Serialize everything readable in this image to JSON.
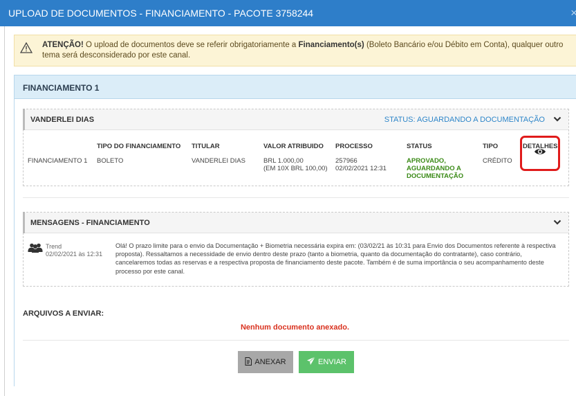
{
  "modal": {
    "title": "UPLOAD DE DOCUMENTOS - FINANCIAMENTO - PACOTE 3758244",
    "close_glyph": "×"
  },
  "alert": {
    "icon": "warning-triangle-icon",
    "strong": "ATENÇÃO!",
    "text1": " O upload de documentos deve se referir obrigatoriamente a ",
    "strong2": "Financiamento(s)",
    "text2": " (Boleto Bancário e/ou Débito em Conta), qualquer outro tema será desconsiderado por este canal."
  },
  "financiamento": {
    "title": "FINANCIAMENTO 1",
    "holder_box": {
      "name": "VANDERLEI DIAS",
      "status": "STATUS: AGUARDANDO A DOCUMENTAÇÃO",
      "columns": [
        "",
        "TIPO DO FINANCIAMENTO",
        "TITULAR",
        "VALOR ATRIBUIDO",
        "PROCESSO",
        "STATUS",
        "TIPO",
        "DETALHES"
      ],
      "row": {
        "label": "FINANCIAMENTO 1",
        "tipo_financiamento": "BOLETO",
        "titular": "VANDERLEI DIAS",
        "valor_1": "BRL 1.000,00",
        "valor_2": "(EM 10X BRL 100,00)",
        "processo_1": "257966",
        "processo_2": "02/02/2021 12:31",
        "status_1": "APROVADO,",
        "status_2": "AGUARDANDO A",
        "status_3": "DOCUMENTAÇÃO",
        "tipo": "CRÉDITO",
        "detalhes_icon": "eye-icon"
      }
    },
    "messages": {
      "title": "MENSAGENS - FINANCIAMENTO",
      "items": [
        {
          "author": "Trend",
          "date": "02/02/2021 às 12:31",
          "text": "Olá! O prazo limite para o envio da Documentação + Biometria necessária expira em: (03/02/21 às 10:31 para Envio dos Documentos referente à respectiva proposta). Ressaltamos a necessidade de envio dentro deste prazo (tanto a biometria, quanto da documentação do contratante), caso contrário, cancelaremos todas as reservas e a respectiva proposta de financiamento deste pacote. Também é de suma importância o seu acompanhamento deste processo por este canal."
        }
      ]
    },
    "files_label": "ARQUIVOS A ENVIAR:",
    "no_files": "Nenhum documento anexado.",
    "buttons": {
      "anexar": "ANEXAR",
      "enviar": "ENVIAR"
    }
  }
}
